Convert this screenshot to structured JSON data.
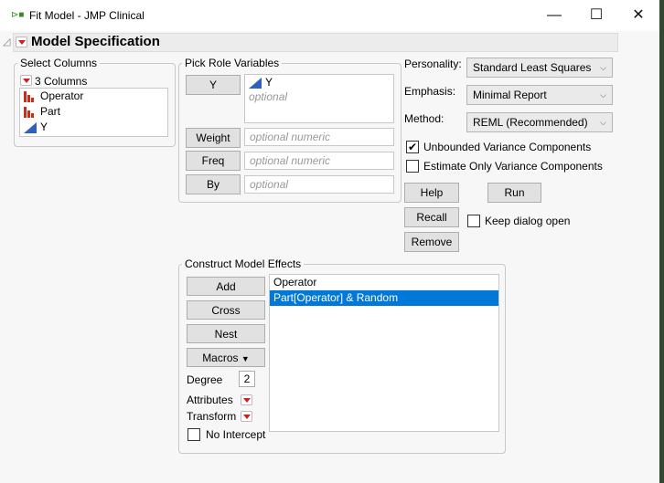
{
  "window": {
    "title": "Fit Model - JMP Clinical",
    "minimize": "—",
    "maximize": "☐",
    "close": "✕"
  },
  "section": {
    "title": "Model Specification"
  },
  "select_columns": {
    "legend": "Select Columns",
    "count": "3 Columns",
    "items": [
      {
        "label": "Operator",
        "type": "nominal"
      },
      {
        "label": "Part",
        "type": "nominal"
      },
      {
        "label": "Y",
        "type": "continuous"
      }
    ]
  },
  "pick_role": {
    "legend": "Pick Role Variables",
    "y_button": "Y",
    "y_value": "Y",
    "y_placeholder": "optional",
    "weight_button": "Weight",
    "weight_placeholder": "optional numeric",
    "freq_button": "Freq",
    "freq_placeholder": "optional numeric",
    "by_button": "By",
    "by_placeholder": "optional"
  },
  "options": {
    "personality_label": "Personality:",
    "personality": "Standard Least Squares",
    "emphasis_label": "Emphasis:",
    "emphasis": "Minimal Report",
    "method_label": "Method:",
    "method": "REML (Recommended)",
    "unbounded_label": "Unbounded Variance Components",
    "unbounded_checked": true,
    "estimate_only_label": "Estimate Only Variance Components",
    "estimate_only_checked": false
  },
  "actions": {
    "help": "Help",
    "run": "Run",
    "recall": "Recall",
    "keep_open": "Keep dialog open",
    "remove": "Remove"
  },
  "effects": {
    "legend": "Construct Model Effects",
    "add": "Add",
    "cross": "Cross",
    "nest": "Nest",
    "macros": "Macros",
    "degree_label": "Degree",
    "degree": "2",
    "attributes": "Attributes",
    "transform": "Transform",
    "no_intercept": "No Intercept",
    "items": [
      "Operator",
      "Part[Operator] & Random"
    ]
  }
}
